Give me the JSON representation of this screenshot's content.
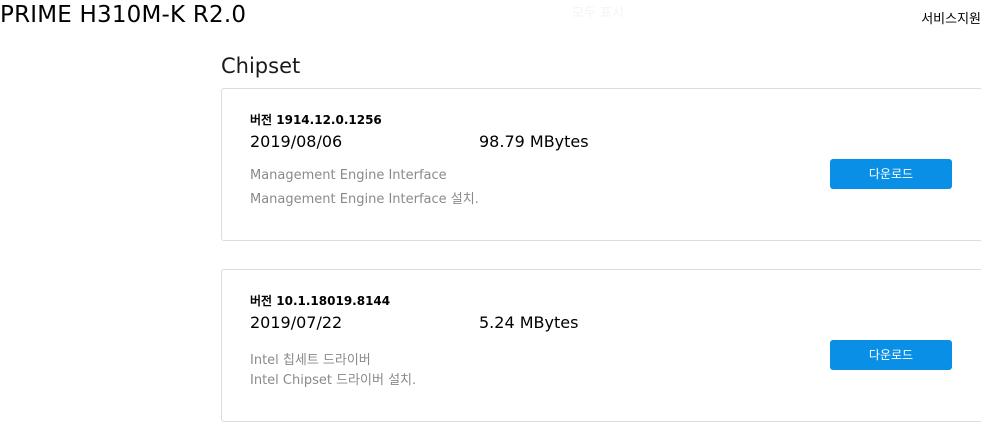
{
  "header": {
    "product_title": "PRIME H310M-K R2.0",
    "show_all": "모두 표시",
    "service_support": "서비스지원"
  },
  "section": {
    "title": "Chipset"
  },
  "drivers": [
    {
      "version": "버전 1914.12.0.1256",
      "date": "2019/08/06",
      "size": "98.79 MBytes",
      "title": "Management Engine Interface",
      "description": "Management Engine Interface 설치.",
      "download_label": "다운로드"
    },
    {
      "version": "버전 10.1.18019.8144",
      "date": "2019/07/22",
      "size": "5.24 MBytes",
      "title": "Intel 칩세트 드라이버",
      "description": "Intel Chipset 드라이버 설치.",
      "download_label": "다운로드"
    }
  ],
  "colors": {
    "download_button": "#0a8fe6",
    "description_text": "#8a8a8a",
    "card_border": "#dcdcdc"
  }
}
